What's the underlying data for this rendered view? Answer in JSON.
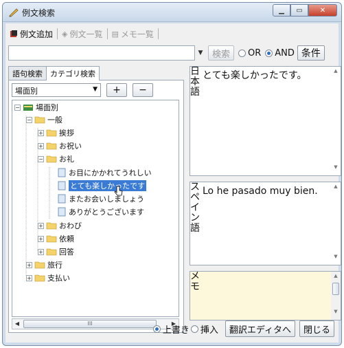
{
  "window": {
    "title": "例文検索"
  },
  "toolbar": {
    "add_label": "例文追加",
    "phrase_list_label": "例文一覧",
    "memo_list_label": "メモ一覧"
  },
  "search": {
    "value": "",
    "search_button": "検索",
    "or_label": "OR",
    "and_label": "AND",
    "selected_mode": "AND",
    "condition_button": "条件"
  },
  "tabs": [
    {
      "label": "語句検索",
      "active": false
    },
    {
      "label": "カテゴリ検索",
      "active": true
    }
  ],
  "category": {
    "selected": "場面別",
    "add_button": "+",
    "remove_button": "−"
  },
  "tree": {
    "root": "場面別",
    "general": "一般",
    "greeting": "挨拶",
    "celebration": "お祝い",
    "thanks": "お礼",
    "leaf1": "お目にかかれてうれしい",
    "leaf2": "とても楽しかったです",
    "leaf3": "またお会いしましょう",
    "leaf4": "ありがとうございます",
    "apology": "おわび",
    "request": "依頼",
    "answer": "回答",
    "travel": "旅行",
    "payment": "支払い",
    "scroll_thumb": "III"
  },
  "panels": {
    "japanese_label": "日本語",
    "japanese_text": "とても楽しかったです。",
    "spanish_label": "スペイン語",
    "spanish_text": "Lo he pasado muy bien.",
    "memo_label": "メモ",
    "memo_text": ""
  },
  "bottom": {
    "overwrite_label": "上書き",
    "insert_label": "挿入",
    "selected_mode": "上書き",
    "editor_button": "翻訳エディタへ",
    "close_button": "閉じる"
  }
}
